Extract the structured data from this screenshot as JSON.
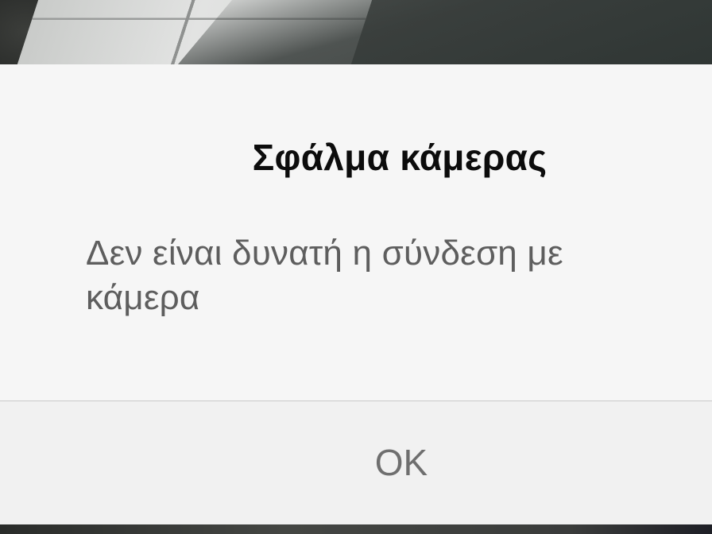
{
  "dialog": {
    "title": "Σφάλμα κάμερας",
    "message": "Δεν είναι δυνατή η σύνδεση με κάμερα",
    "ok_label": "OK"
  },
  "colors": {
    "dialog_background": "#f6f6f6",
    "button_bar_background": "#f1f1f1",
    "title_text": "#0c0c0c",
    "message_text": "#5e5e5e",
    "button_text": "#6f6f6f",
    "divider": "#c9c9c9"
  }
}
